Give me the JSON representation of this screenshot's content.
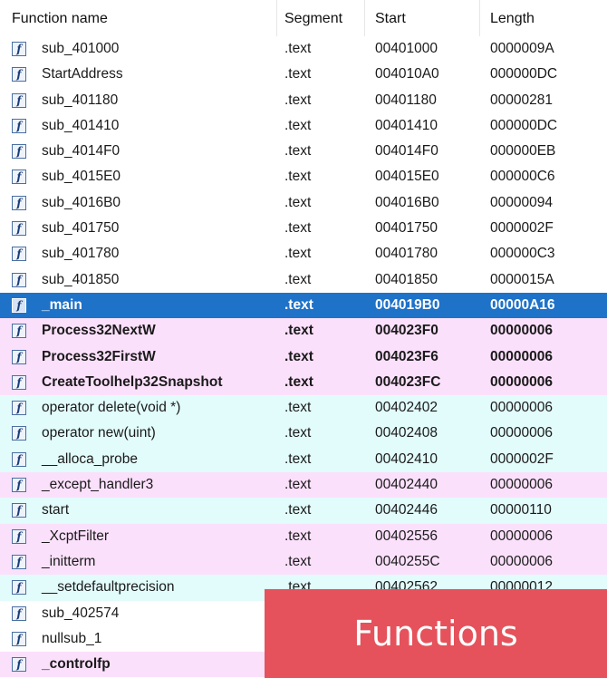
{
  "columns": {
    "name": "Function name",
    "segment": "Segment",
    "start": "Start",
    "length": "Length"
  },
  "rows": [
    {
      "name": "sub_401000",
      "segment": ".text",
      "start": "00401000",
      "length": "0000009A",
      "style": "white",
      "bold": false,
      "selected": false
    },
    {
      "name": "StartAddress",
      "segment": ".text",
      "start": "004010A0",
      "length": "000000DC",
      "style": "white",
      "bold": false,
      "selected": false
    },
    {
      "name": "sub_401180",
      "segment": ".text",
      "start": "00401180",
      "length": "00000281",
      "style": "white",
      "bold": false,
      "selected": false
    },
    {
      "name": "sub_401410",
      "segment": ".text",
      "start": "00401410",
      "length": "000000DC",
      "style": "white",
      "bold": false,
      "selected": false
    },
    {
      "name": "sub_4014F0",
      "segment": ".text",
      "start": "004014F0",
      "length": "000000EB",
      "style": "white",
      "bold": false,
      "selected": false
    },
    {
      "name": "sub_4015E0",
      "segment": ".text",
      "start": "004015E0",
      "length": "000000C6",
      "style": "white",
      "bold": false,
      "selected": false
    },
    {
      "name": "sub_4016B0",
      "segment": ".text",
      "start": "004016B0",
      "length": "00000094",
      "style": "white",
      "bold": false,
      "selected": false
    },
    {
      "name": "sub_401750",
      "segment": ".text",
      "start": "00401750",
      "length": "0000002F",
      "style": "white",
      "bold": false,
      "selected": false
    },
    {
      "name": "sub_401780",
      "segment": ".text",
      "start": "00401780",
      "length": "000000C3",
      "style": "white",
      "bold": false,
      "selected": false
    },
    {
      "name": "sub_401850",
      "segment": ".text",
      "start": "00401850",
      "length": "0000015A",
      "style": "white",
      "bold": false,
      "selected": false
    },
    {
      "name": "_main",
      "segment": ".text",
      "start": "004019B0",
      "length": "00000A16",
      "style": "white",
      "bold": true,
      "selected": true
    },
    {
      "name": "Process32NextW",
      "segment": ".text",
      "start": "004023F0",
      "length": "00000006",
      "style": "pink",
      "bold": true,
      "selected": false
    },
    {
      "name": "Process32FirstW",
      "segment": ".text",
      "start": "004023F6",
      "length": "00000006",
      "style": "pink",
      "bold": true,
      "selected": false
    },
    {
      "name": "CreateToolhelp32Snapshot",
      "segment": ".text",
      "start": "004023FC",
      "length": "00000006",
      "style": "pink",
      "bold": true,
      "selected": false
    },
    {
      "name": "operator delete(void *)",
      "segment": ".text",
      "start": "00402402",
      "length": "00000006",
      "style": "cyan",
      "bold": false,
      "selected": false
    },
    {
      "name": "operator new(uint)",
      "segment": ".text",
      "start": "00402408",
      "length": "00000006",
      "style": "cyan",
      "bold": false,
      "selected": false
    },
    {
      "name": "__alloca_probe",
      "segment": ".text",
      "start": "00402410",
      "length": "0000002F",
      "style": "cyan",
      "bold": false,
      "selected": false
    },
    {
      "name": "_except_handler3",
      "segment": ".text",
      "start": "00402440",
      "length": "00000006",
      "style": "pink",
      "bold": false,
      "selected": false
    },
    {
      "name": "start",
      "segment": ".text",
      "start": "00402446",
      "length": "00000110",
      "style": "cyan",
      "bold": false,
      "selected": false
    },
    {
      "name": "_XcptFilter",
      "segment": ".text",
      "start": "00402556",
      "length": "00000006",
      "style": "pink",
      "bold": false,
      "selected": false
    },
    {
      "name": "_initterm",
      "segment": ".text",
      "start": "0040255C",
      "length": "00000006",
      "style": "pink",
      "bold": false,
      "selected": false
    },
    {
      "name": "__setdefaultprecision",
      "segment": ".text",
      "start": "00402562",
      "length": "00000012",
      "style": "cyan",
      "bold": false,
      "selected": false
    },
    {
      "name": "sub_402574",
      "segment": "",
      "start": "",
      "length": "",
      "style": "white",
      "bold": false,
      "selected": false
    },
    {
      "name": "nullsub_1",
      "segment": "",
      "start": "",
      "length": "",
      "style": "white",
      "bold": false,
      "selected": false
    },
    {
      "name": "_controlfp",
      "segment": "",
      "start": "",
      "length": "",
      "style": "pink",
      "bold": true,
      "selected": false
    }
  ],
  "function_icon_glyph": "f",
  "icon_name": "function-icon",
  "overlay": {
    "label": "Functions",
    "color": "#e5525b"
  },
  "colors": {
    "pink": "#fbe0fb",
    "cyan": "#e2fbfb",
    "selected": "#1e72c8"
  }
}
